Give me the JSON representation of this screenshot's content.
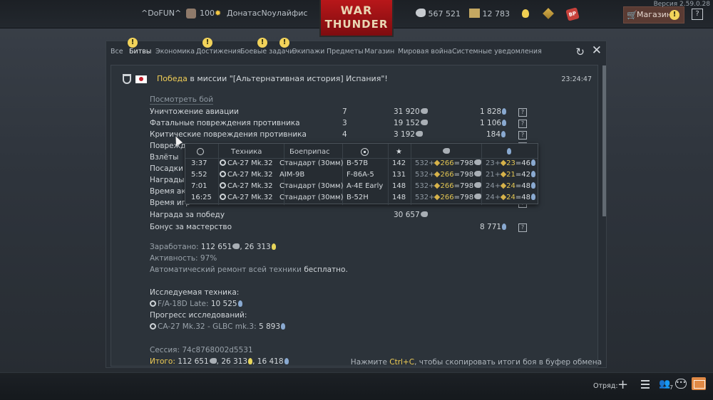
{
  "topbar": {
    "nickname": "^DoFUN^",
    "rank": "100",
    "player": "ДонатасNoулайфис",
    "logo_line1": "WAR",
    "logo_line2": "THUNDER",
    "silver": "567 521",
    "golden_eagles": "12 783",
    "shop_label": "Магазин",
    "version": "Версия 2.59.0.28",
    "help": "?"
  },
  "tabs": [
    {
      "label": "Все",
      "warn": false
    },
    {
      "label": "Битвы",
      "warn": true
    },
    {
      "label": "Экономика",
      "warn": false
    },
    {
      "label": "Достижения",
      "warn": true
    },
    {
      "label": "Боевые задачи",
      "warn": true
    },
    {
      "label": "Экипажи",
      "warn": true
    },
    {
      "label": "Предметы",
      "warn": false
    },
    {
      "label": "Магазин",
      "warn": false
    },
    {
      "label": "Мировая война",
      "warn": false
    },
    {
      "label": "Системные уведомления",
      "warn": false
    }
  ],
  "active_tab": "Битвы",
  "message": {
    "victory": "Победа",
    "title_rest": " в миссии \"[Альтернативная история] Испания\"!",
    "time": "23:24:47",
    "replay_link": "Посмотреть бой"
  },
  "stats": [
    {
      "label": "Уничтожение авиации",
      "count": "7",
      "silver": "31 920",
      "rp": "1 828",
      "q": "?"
    },
    {
      "label": "Фатальные повреждения противника",
      "count": "3",
      "silver": "19 152",
      "rp": "1 106",
      "q": "?"
    },
    {
      "label": "Критические повреждения противника",
      "count": "4",
      "silver": "3 192",
      "rp": "184",
      "q": "?"
    },
    {
      "label": "Поврежде",
      "count": "",
      "silver": "",
      "rp": "",
      "q": "?"
    },
    {
      "label": "Взлёты",
      "count": "",
      "silver": "",
      "rp": "",
      "q": "?"
    },
    {
      "label": "Посадки",
      "count": "",
      "silver": "",
      "rp": "",
      "q": "?"
    },
    {
      "label": "Награды",
      "count": "",
      "silver": "",
      "rp": "",
      "q": "?"
    },
    {
      "label": "Время акт",
      "count": "",
      "silver": "",
      "rp": "",
      "q": "?"
    },
    {
      "label": "Время игр",
      "count": "",
      "silver": "",
      "rp": "",
      "q": "?"
    },
    {
      "label": "Награда за победу",
      "count": "",
      "silver": "30 657",
      "rp": "",
      "q": ""
    },
    {
      "label": "Бонус за мастерство",
      "count": "",
      "silver": "",
      "rp": "8 771",
      "q": "?"
    }
  ],
  "summary": {
    "earned_label": "Заработано:",
    "earned_silver": "112 651",
    "earned_rp": "26 313",
    "activity": "Активность: 97%",
    "repair_text": "Автоматический ремонт всей техники ",
    "repair_value": "бесплатно.",
    "research_label": "Исследуемая техника:",
    "research_vehicle": "F/A-18D Late: ",
    "research_value": "10 525",
    "progress_label": "Прогресс исследований:",
    "progress_vehicle": "CA-27 Mk.32 - GLBC mk.3: ",
    "progress_value": "5 893",
    "session": "Сессия: 74c8768002d5531",
    "total_label": "Итого:",
    "total_silver": "112 651",
    "total_rp": "26 313",
    "total_third": "16 418",
    "copy_hint_pre": "Нажмите ",
    "copy_hint_key": "Ctrl+C",
    "copy_hint_post": ", чтобы скопировать итоги боя в буфер обмена"
  },
  "tooltip": {
    "headers": {
      "vehicle": "Техника",
      "ammo": "Боеприпас"
    },
    "rows": [
      {
        "time": "3:37",
        "vehicle": "CA-27 Mk.32",
        "ammo": "Стандарт (30мм)",
        "target": "B-57B",
        "score": "142",
        "s_base": "532",
        "s_bonus": "266",
        "s_total": "798",
        "r_base": "23",
        "r_bonus": "23",
        "r_total": "46"
      },
      {
        "time": "5:52",
        "vehicle": "CA-27 Mk.32",
        "ammo": "AIM-9B",
        "target": "F-86A-5",
        "score": "131",
        "s_base": "532",
        "s_bonus": "266",
        "s_total": "798",
        "r_base": "21",
        "r_bonus": "21",
        "r_total": "42"
      },
      {
        "time": "7:01",
        "vehicle": "CA-27 Mk.32",
        "ammo": "Стандарт (30мм)",
        "target": "A-4E Early",
        "score": "148",
        "s_base": "532",
        "s_bonus": "266",
        "s_total": "798",
        "r_base": "24",
        "r_bonus": "24",
        "r_total": "48"
      },
      {
        "time": "16:25",
        "vehicle": "CA-27 Mk.32",
        "ammo": "Стандарт (30мм)",
        "target": "B-52H",
        "score": "148",
        "s_base": "532",
        "s_bonus": "266",
        "s_total": "798",
        "r_base": "24",
        "r_bonus": "24",
        "r_total": "48"
      }
    ]
  },
  "bottombar": {
    "squad_label": "Отряд:",
    "friends_count": "7"
  }
}
